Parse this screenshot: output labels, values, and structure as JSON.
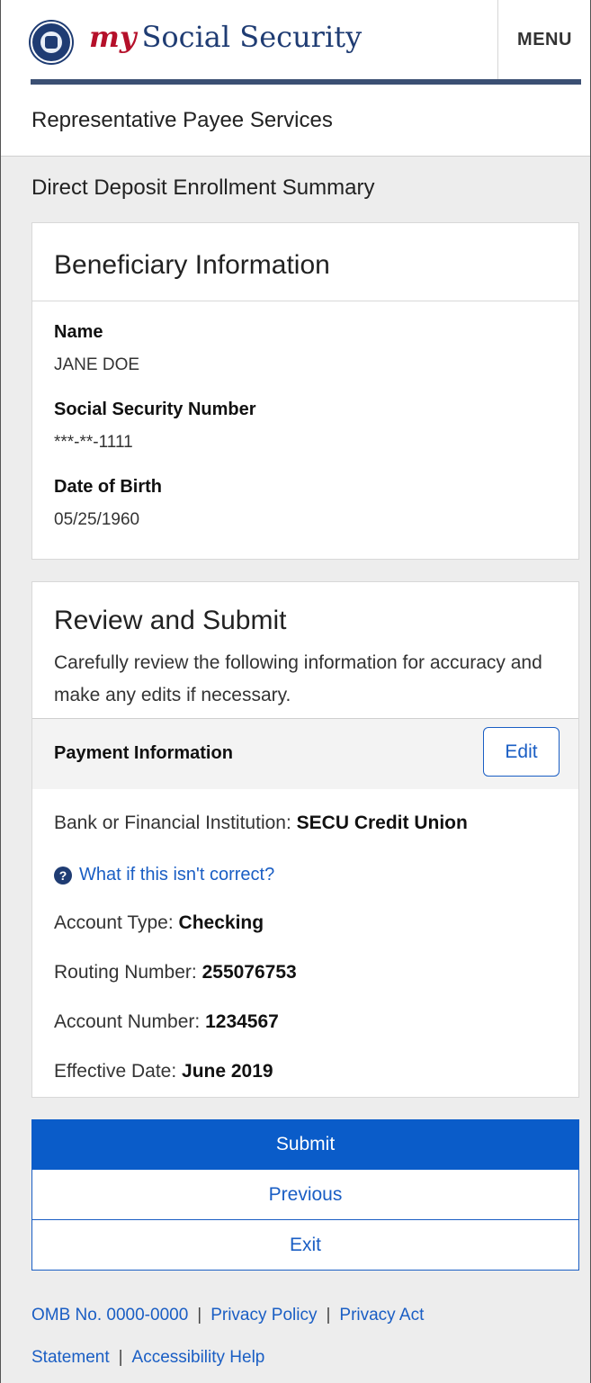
{
  "header": {
    "brand_my": "my",
    "brand_name": "Social Security",
    "menu_label": "MENU",
    "accent_color": "#b5102a",
    "primary_color": "#1f3c73"
  },
  "page": {
    "service_title": "Representative Payee Services",
    "section_heading": "Direct Deposit Enrollment Summary"
  },
  "beneficiary": {
    "title": "Beneficiary Information",
    "fields": [
      {
        "label": "Name",
        "value": "JANE DOE"
      },
      {
        "label": "Social Security Number",
        "value": "***-**-1111"
      },
      {
        "label": "Date of Birth",
        "value": "05/25/1960"
      }
    ]
  },
  "review": {
    "title": "Review and Submit",
    "description": "Carefully review the following information for accuracy and make any edits if necessary.",
    "payment_header": "Payment Information",
    "edit_label": "Edit",
    "bank_label": "Bank or Financial Institution:",
    "bank_value": "SECU Credit Union",
    "help_link": "What if this isn't correct?",
    "help_icon": "question-circle-icon",
    "account_type_label": "Account Type:",
    "account_type_value": "Checking",
    "routing_label": "Routing Number:",
    "routing_value": "255076753",
    "account_number_label": "Account Number:",
    "account_number_value": "1234567",
    "effective_date_label": "Effective Date:",
    "effective_date_value": "June 2019"
  },
  "actions": {
    "submit": "Submit",
    "previous": "Previous",
    "exit": "Exit"
  },
  "footer": {
    "omb": "OMB No. 0000-0000",
    "privacy_policy": "Privacy Policy",
    "privacy_act": "Privacy Act Statement",
    "accessibility": "Accessibility Help",
    "separator": "|"
  }
}
